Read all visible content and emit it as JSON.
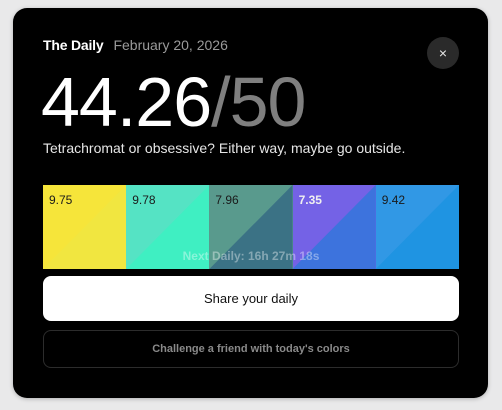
{
  "header": {
    "brand": "The Daily",
    "date": "February 20, 2026",
    "close_glyph": "×",
    "close_icon": "close-icon"
  },
  "score": {
    "value": "44.26",
    "separator": "/",
    "max": "50"
  },
  "tagline": "Tetrachromat or obsessive? Either way, maybe go outside.",
  "swatches": [
    {
      "score": "9.75",
      "target": "#f6e53a",
      "guess": "#f1e640",
      "bold": false
    },
    {
      "score": "9.78",
      "target": "#55e3c4",
      "guess": "#3fefc2",
      "bold": false
    },
    {
      "score": "7.96",
      "target": "#599a8d",
      "guess": "#3b7285",
      "bold": false
    },
    {
      "score": "7.35",
      "target": "#7462e6",
      "guess": "#3d73dd",
      "bold": true
    },
    {
      "score": "9.42",
      "target": "#3198e5",
      "guess": "#1f94e2",
      "bold": false
    }
  ],
  "next_daily": "Next Daily: 16h 27m 18s",
  "actions": {
    "share_label": "Share your daily",
    "challenge_label": "Challenge a friend with today's colors"
  },
  "colors": {
    "card_bg": "#000000",
    "page_bg": "#e9e9ea",
    "share_bg": "#ffffff",
    "muted_text": "#9a9a9a"
  }
}
